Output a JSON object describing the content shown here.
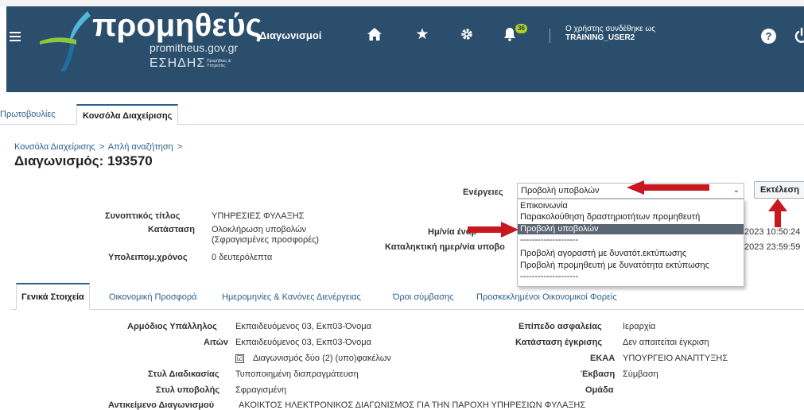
{
  "header": {
    "logo_text": "προμηθεύς",
    "logo_domain": "promitheus.gov.gr",
    "logo_org": "ΕΣΗΔΗΣ",
    "logo_org_sub": "Προμήθειες & Υπηρεσίες",
    "app_title": "Διαγωνισμοί",
    "notification_count": "36",
    "user_label": "Ο χρήστης συνδέθηκε ως",
    "user_name": "TRAINING_USER2",
    "help_label": "?"
  },
  "top_tabs": [
    {
      "label": "Πρωτοβουλίες"
    },
    {
      "label": "Κονσόλα Διαχείρισης"
    }
  ],
  "breadcrumb": {
    "items": [
      "Κονσόλα Διαχείρισης",
      "Απλή αναζήτηση"
    ],
    "separator": ">"
  },
  "page_title": "Διαγωνισμός: 193570",
  "actions": {
    "label": "Ενέργειες",
    "selected": "Προβολή υποβολών",
    "execute_label": "Εκτέλεση",
    "options": [
      "Επικοινωνία",
      "Παρακολούθηση δραστηριοτήτων προμηθευτή",
      "Προβολή υποβολών",
      "--------------------",
      "Προβολή αγοραστή με δυνατότ.εκτύπωσης",
      "Προβολή προμηθευτή με δυνατότητα εκτύπωσης",
      "--------------------"
    ]
  },
  "summary": {
    "short_title_label": "Συνοπτικός τίτλος",
    "short_title_value": "ΥΠΗΡΕΣΙΕΣ ΦΥΛΑΞΗΣ",
    "status_label": "Κατάσταση",
    "status_value_1": "Ολοκλήρωση υποβολών",
    "status_value_2": "(Σφραγισμένες προσφορές)",
    "remaining_label": "Υπολειπομ.χρόνος",
    "remaining_value": "0 δευτερόλεπτα",
    "start_date_label": "Ημ/νία έναρ",
    "start_date_value": "2023 10:50:24",
    "close_date_label": "Καταληκτική ημερ/νία υποβο",
    "close_date_value": "2023 23:59:59"
  },
  "content_tabs": [
    {
      "label": "Γενικά Στοιχεία"
    },
    {
      "label": "Οικονομική Προσφορά"
    },
    {
      "label": "Ημερομηνίες & Κανόνες Διενέργειας"
    },
    {
      "label": "Όροι σύμβασης"
    },
    {
      "label": "Προσκεκλημένοι Οικονομικοί Φορείς"
    }
  ],
  "general": {
    "officer_label": "Αρμόδιος Υπάλληλος",
    "officer_value": "Εκπαιδευόμενος 03, Εκπ03-Όνομα",
    "requester_label": "Αιτών",
    "requester_value": "Εκπαιδευόμενος 03, Εκπ03-Όνομα",
    "two_envelopes_label": "Διαγωνισμός δύο (2) (υπο)φακέλων",
    "two_envelopes_checked": "☑",
    "procedure_label": "Στυλ Διαδικασίας",
    "procedure_value": "Τυποποιημένη διαπραγμάτευση",
    "submission_label": "Στυλ υποβολής",
    "submission_value": "Σφραγισμένη",
    "subject_label": "Αντικείμενο Διαγωνισμού",
    "subject_value": "ΑΚΟΙΚΤΟΣ ΗΛΕΚΤΡΟΝΙΚΟΣ ΔΙΑΓΩΝΙΣΜΟΣ ΓΙΑ ΤΗΝ ΠΑΡΟΧΗ ΥΠΗΡΕΣΙΩΝ ΦΥΛΑΞΗΣ",
    "security_label": "Επίπεδο ασφαλείας",
    "security_value": "Ιεραρχία",
    "approval_label": "Κατάσταση έγκρισης",
    "approval_value": "Δεν απαιτείται έγκριση",
    "ekaa_label": "ΕΚΑΑ",
    "ekaa_value": "ΥΠΟΥΡΓΕΙΟ ΑΝΑΠΤΥΞΗΣ",
    "outcome_label": "Έκβαση",
    "outcome_value": "Σύμβαση",
    "group_label": "Ομάδα"
  },
  "colors": {
    "header_bg": "#2b4e6c",
    "link": "#2b5f89",
    "annotation_arrow": "#c8181e",
    "selected_option_bg": "#5b6673"
  }
}
